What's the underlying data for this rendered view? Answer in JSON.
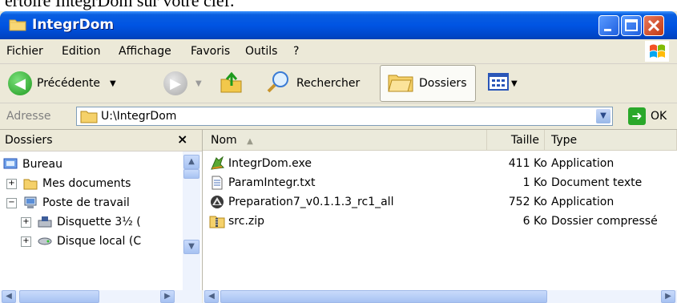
{
  "caption": "ertoire IntegrDom sur votre clef.",
  "window": {
    "title": "IntegrDom"
  },
  "menu": [
    "Fichier",
    "Edition",
    "Affichage",
    "Favoris",
    "Outils",
    "?"
  ],
  "toolbar": {
    "back_label": "Précédente",
    "search_label": "Rechercher",
    "folders_label": "Dossiers"
  },
  "address": {
    "label": "Adresse",
    "value": "U:\\IntegrDom",
    "go_label": "OK"
  },
  "folders_pane": {
    "title": "Dossiers",
    "close_glyph": "×",
    "items": [
      {
        "label": "Bureau"
      },
      {
        "label": "Mes documents"
      },
      {
        "label": "Poste de travail"
      },
      {
        "label": "Disquette 3½ ("
      },
      {
        "label": "Disque local (C"
      }
    ]
  },
  "file_list": {
    "columns": {
      "name": "Nom",
      "size": "Taille",
      "type": "Type"
    },
    "rows": [
      {
        "name": "IntegrDom.exe",
        "size": "411 Ko",
        "type": "Application",
        "icon": "app-exe-icon"
      },
      {
        "name": "ParamIntegr.txt",
        "size": "1 Ko",
        "type": "Document texte",
        "icon": "text-file-icon"
      },
      {
        "name": "Preparation7_v0.1.1.3_rc1_all",
        "size": "752 Ko",
        "type": "Application",
        "icon": "installer-icon"
      },
      {
        "name": "src.zip",
        "size": "6 Ko",
        "type": "Dossier compressé",
        "icon": "zip-folder-icon"
      }
    ]
  },
  "colors": {
    "titlebar": "#0054e3",
    "chrome": "#ece9d8",
    "close_button": "#c23a14"
  }
}
